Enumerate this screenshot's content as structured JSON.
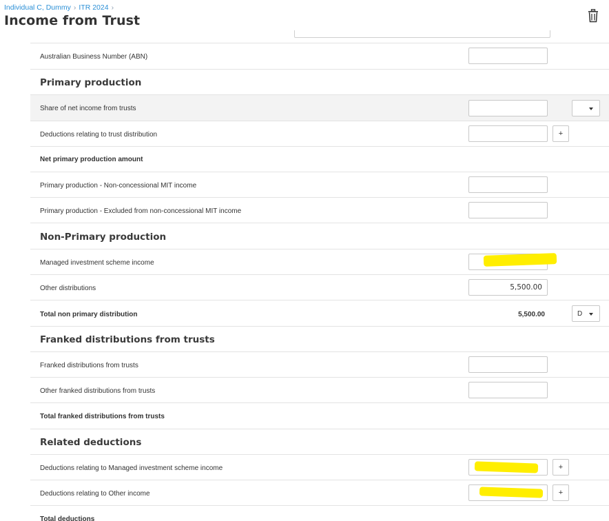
{
  "header": {
    "breadcrumb": [
      "Individual C, Dummy",
      "ITR 2024"
    ],
    "separator": "›",
    "title": "Income from Trust",
    "delete_icon": "trash-icon"
  },
  "rows": {
    "abn": {
      "label": "Australian Business Number (ABN)",
      "value": ""
    },
    "primary_heading": "Primary production",
    "share_net_income": {
      "label": "Share of net income from trusts",
      "value": "",
      "dropdown": ""
    },
    "deductions_trust_distribution": {
      "label": "Deductions relating to trust distribution",
      "value": "",
      "button": "+"
    },
    "net_pp_amount": {
      "label": "Net primary production amount"
    },
    "pp_non_concessional": {
      "label": "Primary production - Non-concessional MIT income",
      "value": ""
    },
    "pp_excluded": {
      "label": "Primary production - Excluded from non-concessional MIT income",
      "value": ""
    },
    "non_primary_heading": "Non-Primary production",
    "mis_income": {
      "label": "Managed investment scheme income",
      "value": "0.00"
    },
    "other_distributions": {
      "label": "Other distributions",
      "value": "5,500.00"
    },
    "total_non_primary": {
      "label": "Total non primary distribution",
      "value": "5,500.00",
      "dropdown": "D"
    },
    "franked_heading": "Franked distributions from trusts",
    "franked_distributions": {
      "label": "Franked distributions from trusts",
      "value": ""
    },
    "other_franked": {
      "label": "Other franked distributions from trusts",
      "value": ""
    },
    "total_franked": {
      "label": "Total franked distributions from trusts"
    },
    "related_heading": "Related deductions",
    "ded_mis": {
      "label": "Deductions relating to Managed investment scheme income",
      "value": "",
      "button": "+"
    },
    "ded_other": {
      "label": "Deductions relating to Other income",
      "value": "",
      "button": "+"
    },
    "total_deductions": {
      "label": "Total deductions"
    }
  },
  "colors": {
    "link": "#2b8fd6",
    "highlight": "#ffee00",
    "border": "#c8c8c8",
    "shaded_row": "#f3f3f3"
  }
}
